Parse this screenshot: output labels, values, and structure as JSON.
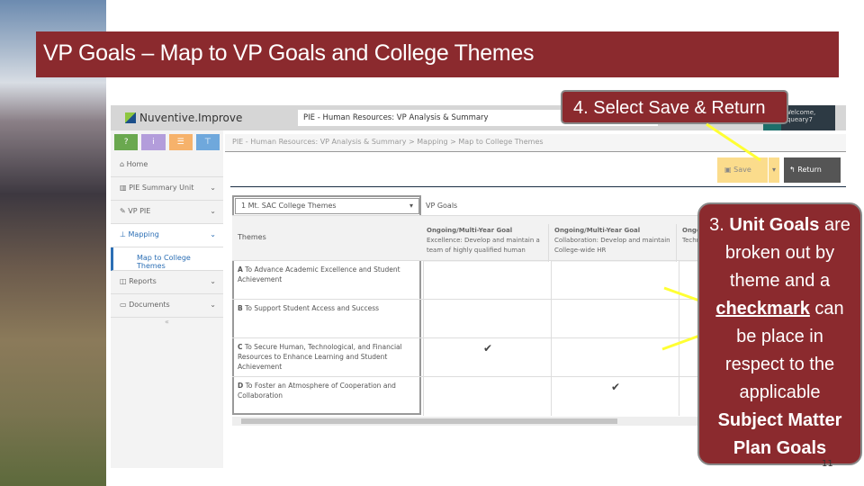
{
  "slide": {
    "title": "VP Goals – Map to VP Goals and College Themes",
    "page_number": "11"
  },
  "app": {
    "logo": "Nuventive.Improve",
    "unit_selector": "PIE - Human Resources: VP Analysis & Summary",
    "user": "Welcome, jqueary7",
    "toolbar": [
      "?",
      "i",
      "☰",
      "⊤"
    ],
    "breadcrumb": "PIE - Human Resources: VP Analysis & Summary  >  Mapping  >  Map to College Themes",
    "save_label": "Save",
    "return_label": "Return",
    "nav": [
      {
        "label": "Home"
      },
      {
        "label": "PIE Summary Unit"
      },
      {
        "label": "VP PIE"
      },
      {
        "label": "Mapping"
      },
      {
        "label": "Map to College Themes"
      },
      {
        "label": "Reports"
      },
      {
        "label": "Documents"
      }
    ],
    "theme_select": "1 Mt. SAC College Themes",
    "themes_header": "Themes",
    "goals_header": "VP Goals",
    "goals": [
      {
        "type": "Ongoing/Multi-Year Goal",
        "text": "Excellence: Develop and maintain a team of highly qualified human"
      },
      {
        "type": "Ongoing/Multi-Year Goal",
        "text": "Collaboration: Develop and maintain College-wide HR"
      },
      {
        "type": "Ongoing/Multi-Year Goal",
        "text": "Technology: ... the e..."
      }
    ],
    "themes": [
      {
        "letter": "A",
        "text": "To Advance Academic Excellence and Student Achievement",
        "checks": [
          false,
          false,
          false
        ]
      },
      {
        "letter": "B",
        "text": "To Support Student Access and Success",
        "checks": [
          false,
          false,
          false
        ]
      },
      {
        "letter": "C",
        "text": "To Secure Human, Technological, and Financial Resources to Enhance Learning and Student Achievement",
        "checks": [
          true,
          false,
          false
        ]
      },
      {
        "letter": "D",
        "text": "To Foster an Atmosphere of Cooperation and Collaboration",
        "checks": [
          false,
          true,
          false
        ]
      }
    ]
  },
  "callouts": {
    "step4": "4. Select Save & Return",
    "step3": {
      "p1": "3. ",
      "b1": "Unit Goals",
      "p2": " are broken out by theme and a ",
      "b2": "checkmark",
      "p3": " can be place in respect to the applicable ",
      "b3": "Subject Matter Plan Goals"
    }
  }
}
